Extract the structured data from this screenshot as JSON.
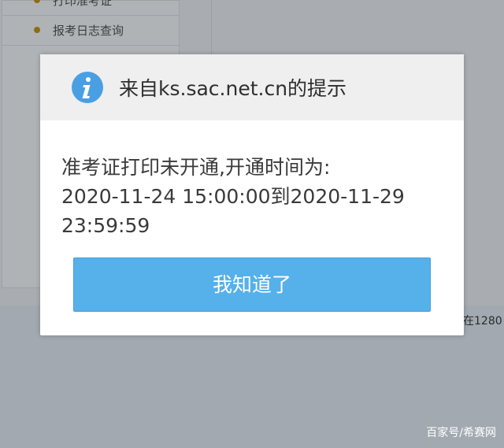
{
  "background": {
    "sidebar_items": [
      {
        "label": "打印准考证"
      },
      {
        "label": "报考日志查询"
      }
    ],
    "edge_text": "在1280",
    "watermark": "百家号/希赛网"
  },
  "dialog": {
    "icon": "info-icon",
    "title": "来自ks.sac.net.cn的提示",
    "message": "准考证打印未开通,开通时间为:\n2020-11-24 15:00:00到2020-11-29\n23:59:59",
    "ok_label": "我知道了"
  },
  "colors": {
    "accent": "#56b0ea",
    "icon": "#4a9fe3"
  }
}
